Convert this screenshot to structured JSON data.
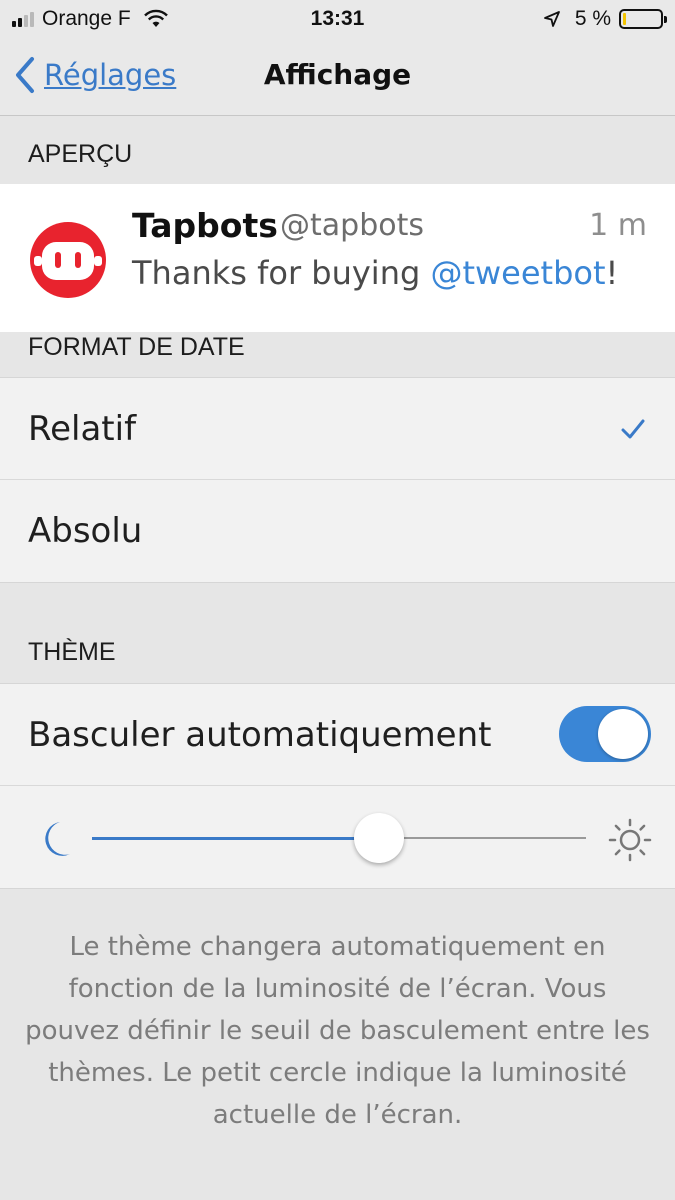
{
  "status_bar": {
    "carrier": "Orange F",
    "time": "13:31",
    "battery_percent": "5 %",
    "battery_level": 0.05,
    "signal_bars": 2
  },
  "nav": {
    "back_label": "Réglages",
    "title": "Affichage"
  },
  "preview": {
    "header": "APERÇU",
    "name": "Tapbots",
    "handle": "@tapbots",
    "time": "1 m",
    "body_prefix": "Thanks for buying ",
    "mention": "@tweetbot",
    "body_suffix": "!",
    "accent_color": "#3a86d6",
    "avatar_color": "#e8232e"
  },
  "date_format": {
    "header": "FORMAT DE DATE",
    "options": [
      {
        "label": "Relatif",
        "selected": true
      },
      {
        "label": "Absolu",
        "selected": false
      }
    ]
  },
  "theme": {
    "header": "THÈME",
    "auto_switch_label": "Basculer automatiquement",
    "auto_switch_on": true,
    "brightness_threshold": 0.58,
    "left_icon": "moon-icon",
    "right_icon": "sun-icon",
    "note": "Le thème changera automatiquement en fonction de la luminosité de l’écran. Vous pouvez définir le seuil de basculement entre les thèmes. Le petit cercle indique la luminosité actuelle de l’écran."
  }
}
